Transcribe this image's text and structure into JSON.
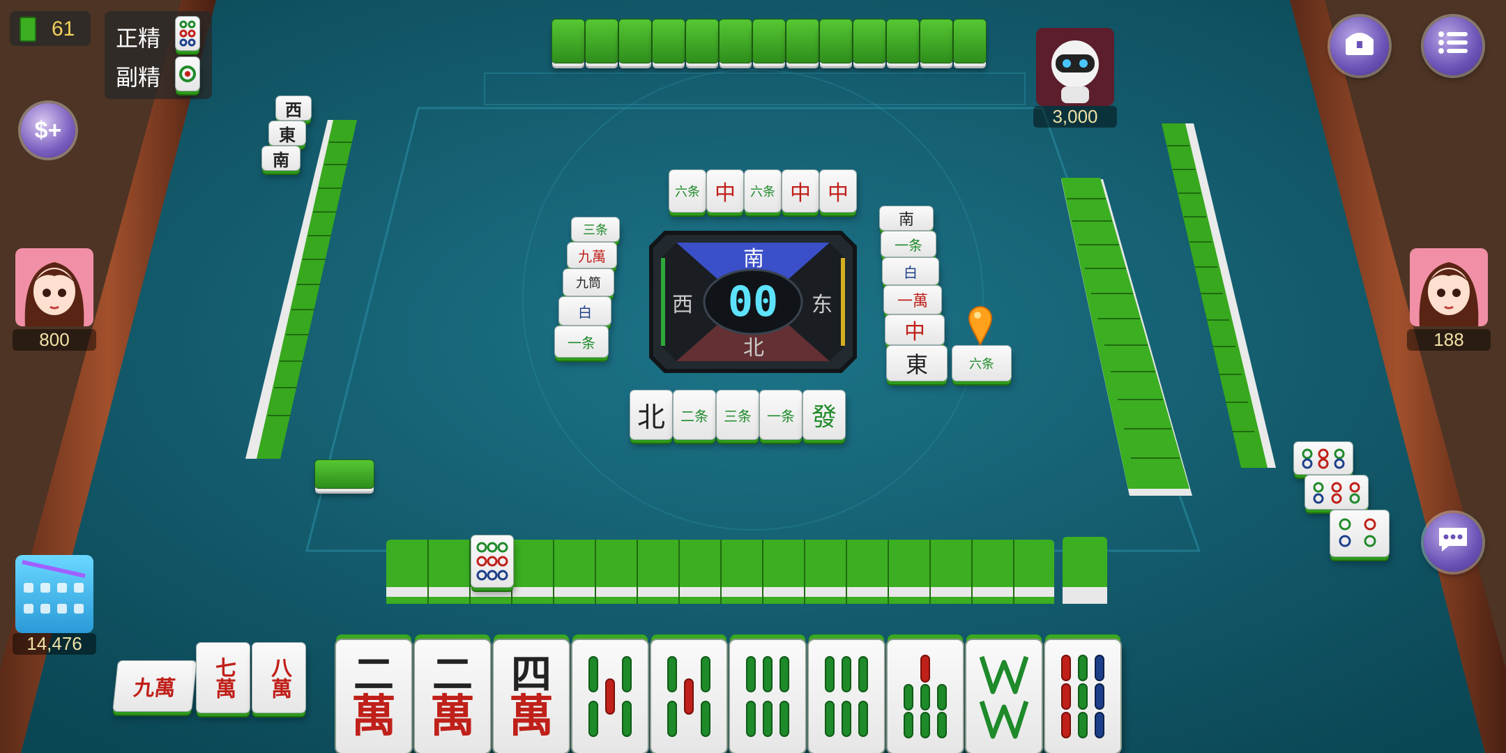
{
  "hud": {
    "tiles_remaining": "61",
    "main_wild_label": "正精",
    "sub_wild_label": "副精"
  },
  "players": {
    "top": {
      "score": "3,000"
    },
    "left": {
      "score": "800"
    },
    "right": {
      "score": "188"
    },
    "self": {
      "score": "14,476"
    }
  },
  "center": {
    "timer": "00",
    "wind_top": "南",
    "wind_left": "西",
    "wind_right": "东",
    "wind_bottom": "北"
  },
  "icons": {
    "treasure": "treasure-chest-icon",
    "menu": "menu-list-icon",
    "add_coins": "add-coins-icon",
    "chat": "chat-icon",
    "tile_counter": "tile-counter-icon"
  },
  "melds": {
    "left_top": [
      "西",
      "東",
      "南"
    ],
    "self_exposed": [
      "九萬",
      "七萬",
      "八萬"
    ]
  },
  "discards": {
    "top": [
      "六条",
      "中",
      "六条",
      "中",
      "中"
    ],
    "bottom": [
      "北",
      "二条",
      "三条",
      "一条",
      "發"
    ],
    "left": [
      "三条",
      "九萬",
      "九筒",
      "白",
      "一条"
    ],
    "right": [
      "南",
      "一条",
      "白",
      "一萬",
      "中",
      "東",
      "六条"
    ]
  },
  "hand": [
    {
      "num": "二",
      "suit": "萬"
    },
    {
      "num": "二",
      "suit": "萬"
    },
    {
      "num": "四",
      "suit": "萬"
    },
    {
      "bamboo": 5
    },
    {
      "bamboo": 5
    },
    {
      "bamboo": 6
    },
    {
      "bamboo": 6
    },
    {
      "bamboo": 7
    },
    {
      "bamboo": 8
    },
    {
      "bamboo": 9
    }
  ],
  "colors": {
    "felt": "#0f5a6b",
    "tile_back": "#3cae22",
    "rail": "#7a3b22"
  }
}
